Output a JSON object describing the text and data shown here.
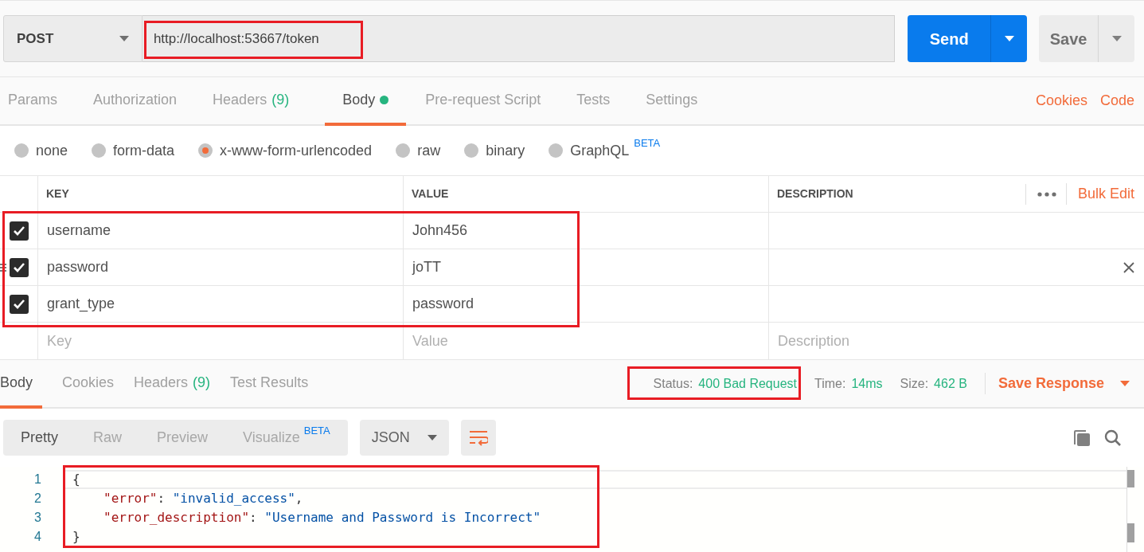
{
  "request": {
    "method": "POST",
    "url": "http://localhost:53667/token",
    "send": "Send",
    "save": "Save"
  },
  "request_tabs": [
    {
      "label": "Params",
      "selected": false
    },
    {
      "label": "Authorization",
      "selected": false
    },
    {
      "label": "Headers",
      "count": "(9)",
      "selected": false
    },
    {
      "label": "Body",
      "dot": true,
      "selected": true
    },
    {
      "label": "Pre-request Script",
      "selected": false
    },
    {
      "label": "Tests",
      "selected": false
    },
    {
      "label": "Settings",
      "selected": false
    }
  ],
  "request_links": [
    "Cookies",
    "Code"
  ],
  "body_types": [
    {
      "label": "none",
      "selected": false
    },
    {
      "label": "form-data",
      "selected": false
    },
    {
      "label": "x-www-form-urlencoded",
      "selected": true
    },
    {
      "label": "raw",
      "selected": false
    },
    {
      "label": "binary",
      "selected": false
    },
    {
      "label": "GraphQL",
      "badge": "BETA",
      "selected": false
    }
  ],
  "table": {
    "columns": [
      "KEY",
      "VALUE",
      "DESCRIPTION"
    ],
    "bulk_edit": "Bulk Edit",
    "rows": [
      {
        "key": "username",
        "value": "John456",
        "checked": true,
        "hovered": false
      },
      {
        "key": "password",
        "value": "joTT",
        "checked": true,
        "hovered": true
      },
      {
        "key": "grant_type",
        "value": "password",
        "checked": true,
        "hovered": false
      }
    ],
    "new_row": [
      {
        "placeholder": "Key"
      },
      {
        "placeholder": "Value"
      },
      {
        "placeholder": "Description"
      }
    ]
  },
  "response_tabs": [
    {
      "label": "Body",
      "selected": true
    },
    {
      "label": "Cookies",
      "selected": false
    },
    {
      "label": "Headers",
      "count": "(9)",
      "selected": false
    },
    {
      "label": "Test Results",
      "selected": false
    }
  ],
  "response_meta": [
    {
      "label": "Status:",
      "value": "400 Bad Request"
    },
    {
      "label": "Time:",
      "value": "14ms"
    },
    {
      "label": "Size:",
      "value": "462 B"
    }
  ],
  "save_response": "Save Response",
  "view_modes": [
    {
      "label": "Pretty",
      "selected": true
    },
    {
      "label": "Raw",
      "selected": false
    },
    {
      "label": "Preview",
      "selected": false
    },
    {
      "label": "Visualize",
      "badge": "BETA",
      "selected": false
    }
  ],
  "format": "JSON",
  "code": [
    {
      "number": "1",
      "indent": false,
      "tokens": [
        {
          "kind": "punct",
          "text": "{"
        }
      ]
    },
    {
      "number": "2",
      "indent": true,
      "tokens": [
        {
          "kind": "key",
          "text": "\"error\""
        },
        {
          "kind": "punct",
          "text": ": "
        },
        {
          "kind": "string",
          "text": "\"invalid_access\""
        },
        {
          "kind": "punct",
          "text": ","
        }
      ]
    },
    {
      "number": "3",
      "indent": true,
      "tokens": [
        {
          "kind": "key",
          "text": "\"error_description\""
        },
        {
          "kind": "punct",
          "text": ": "
        },
        {
          "kind": "string",
          "text": "\"Username and Password is Incorrect\""
        }
      ]
    },
    {
      "number": "4",
      "indent": false,
      "tokens": [
        {
          "kind": "punct",
          "text": "}"
        }
      ]
    }
  ]
}
